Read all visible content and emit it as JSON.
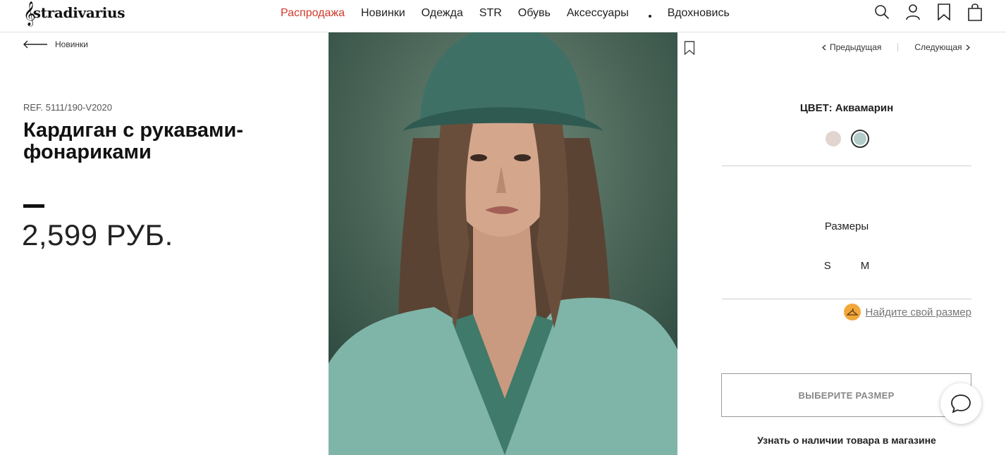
{
  "header": {
    "logo_text": "stradivarius",
    "nav": [
      "Распродажа",
      "Новинки",
      "Одежда",
      "STR",
      "Обувь",
      "Аксессуары"
    ],
    "nav_last": "Вдохновись",
    "icons": [
      "search-icon",
      "account-icon",
      "bookmark-icon",
      "bag-icon"
    ]
  },
  "breadcrumb": {
    "back_label": "Новинки"
  },
  "product": {
    "ref": "REF. 5111/190-V2020",
    "title": "Кардиган с рукавами-фонариками",
    "price": "2,599 РУБ."
  },
  "navigation": {
    "prev": "Предыдущая",
    "next": "Следующая"
  },
  "color": {
    "label": "ЦВЕТ: Аквамарин",
    "swatches": [
      {
        "name": "beige",
        "hex": "#e2d5d0",
        "selected": false
      },
      {
        "name": "aquamarine",
        "hex": "#b2ccc9",
        "selected": true
      }
    ]
  },
  "sizes": {
    "label": "Размеры",
    "options": [
      "S",
      "M"
    ]
  },
  "find_size": {
    "label": "Найдите свой размер"
  },
  "actions": {
    "select_size_button": "ВЫБЕРИТЕ РАЗМЕР",
    "store_availability": "Узнать о наличии товара в магазине"
  },
  "colors": {
    "sale": "#cf3a2c",
    "accent_hanger": "#f2a73a"
  }
}
